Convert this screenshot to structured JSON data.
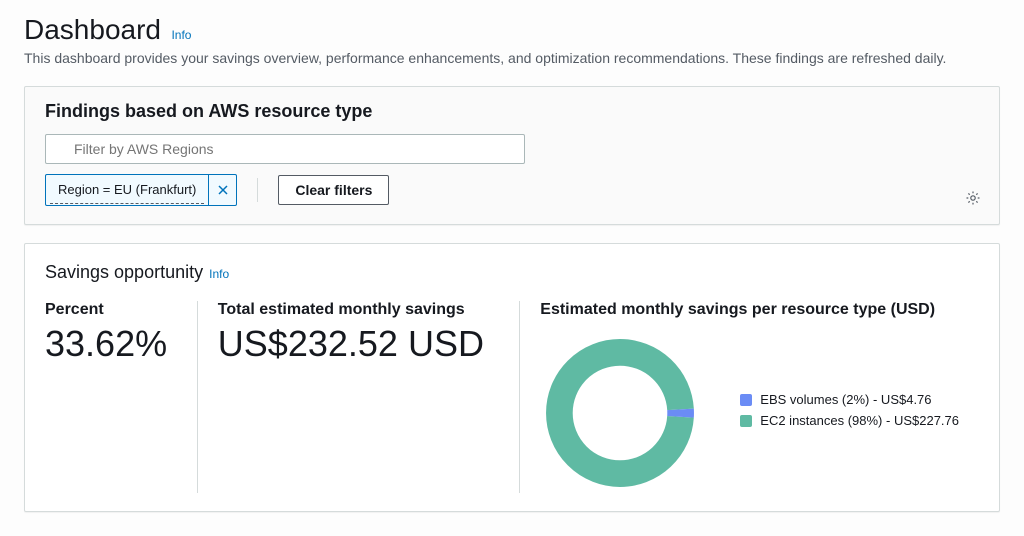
{
  "header": {
    "title": "Dashboard",
    "info": "Info",
    "subtitle": "This dashboard provides your savings overview, performance enhancements, and optimization recommendations. These findings are refreshed daily."
  },
  "findings": {
    "title": "Findings based on AWS resource type",
    "filter_placeholder": "Filter by AWS Regions",
    "token_label": "Region = EU (Frankfurt)",
    "clear_filters": "Clear filters"
  },
  "savings": {
    "title": "Savings opportunity",
    "info": "Info",
    "percent_label": "Percent",
    "percent_value": "33.62%",
    "total_label": "Total estimated monthly savings",
    "total_value": "US$232.52 USD",
    "chart_title": "Estimated monthly savings per resource type (USD)",
    "legend": [
      {
        "label": "EBS volumes (2%) - US$4.76",
        "color": "#6b8cf5"
      },
      {
        "label": "EC2 instances (98%) - US$227.76",
        "color": "#5fbaa3"
      }
    ]
  },
  "chart_data": {
    "type": "pie",
    "title": "Estimated monthly savings per resource type (USD)",
    "series": [
      {
        "name": "EBS volumes",
        "value": 4.76,
        "percent": 2,
        "color": "#6b8cf5"
      },
      {
        "name": "EC2 instances",
        "value": 227.76,
        "percent": 98,
        "color": "#5fbaa3"
      }
    ]
  }
}
